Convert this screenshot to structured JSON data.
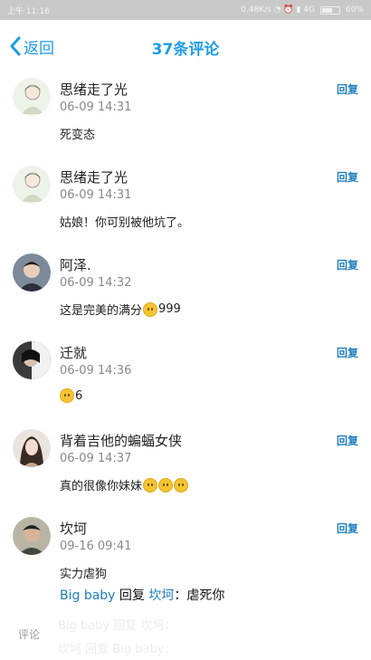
{
  "status_bar": {
    "left": "上午 11:16",
    "right": "0.48K/s  ◔  ⏰  ▮  4G",
    "battery": "60%",
    "battery_level": 0.6
  },
  "nav": {
    "back_label": "返回",
    "title": "37条评论"
  },
  "reply_label": "回复",
  "comments": [
    {
      "name": "思绪走了光",
      "time": "06-09 14:31",
      "content": "死变态",
      "emoji_count": 0,
      "suffix": ""
    },
    {
      "name": "思绪走了光",
      "time": "06-09 14:31",
      "content": "姑娘！你可别被他坑了。",
      "emoji_count": 0,
      "suffix": ""
    },
    {
      "name": "阿泽.",
      "time": "06-09 14:32",
      "content": "这是完美的满分",
      "emoji_count": 1,
      "suffix": "999"
    },
    {
      "name": "迁就",
      "time": "06-09 14:36",
      "content": "",
      "emoji_count": 1,
      "suffix": "6"
    },
    {
      "name": "背着吉他的蝙蝠女侠",
      "time": "06-09 14:37",
      "content": "真的很像你妹妹",
      "emoji_count": 3,
      "suffix": ""
    },
    {
      "name": "坎坷",
      "time": "09-16 09:41",
      "content": "实力虐狗",
      "emoji_count": 0,
      "suffix": ""
    }
  ],
  "sub_reply": {
    "from": "Big baby",
    "verb": "回复",
    "to": "坎坷",
    "separator": "：",
    "text": "虐死你"
  },
  "ghost_lines": [
    {
      "from": "Big baby",
      "verb": "回复",
      "to": "坎坷",
      "text": "："
    },
    {
      "from": "坎坷",
      "verb": "回复",
      "to": "Big baby",
      "text": "："
    }
  ],
  "input": {
    "label": "评论"
  }
}
